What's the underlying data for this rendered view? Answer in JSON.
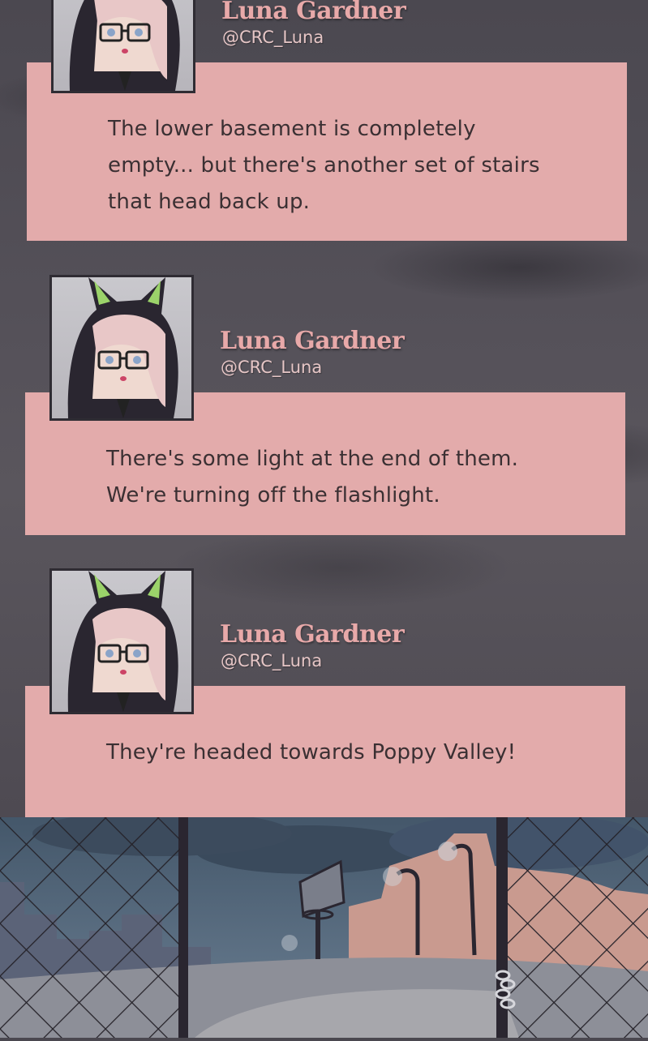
{
  "posts": [
    {
      "name": "Luna Gardner",
      "handle": "@CRC_Luna",
      "text": "The lower basement is completely\nempty... but there's another set of stairs\nthat head back up."
    },
    {
      "name": "Luna Gardner",
      "handle": "@CRC_Luna",
      "text": "There's some light at the end of them.\nWe're turning off the flashlight."
    },
    {
      "name": "Luna Gardner",
      "handle": "@CRC_Luna",
      "text": "They're headed towards Poppy Valley!"
    }
  ],
  "colors": {
    "bubble": "#e3abab",
    "name": "#e8a9a9",
    "text": "#3b3033",
    "background": "#4b4850"
  },
  "icons": [
    "avatar-cat-hood-girl",
    "basketball-hoop",
    "chain-link-fence"
  ]
}
